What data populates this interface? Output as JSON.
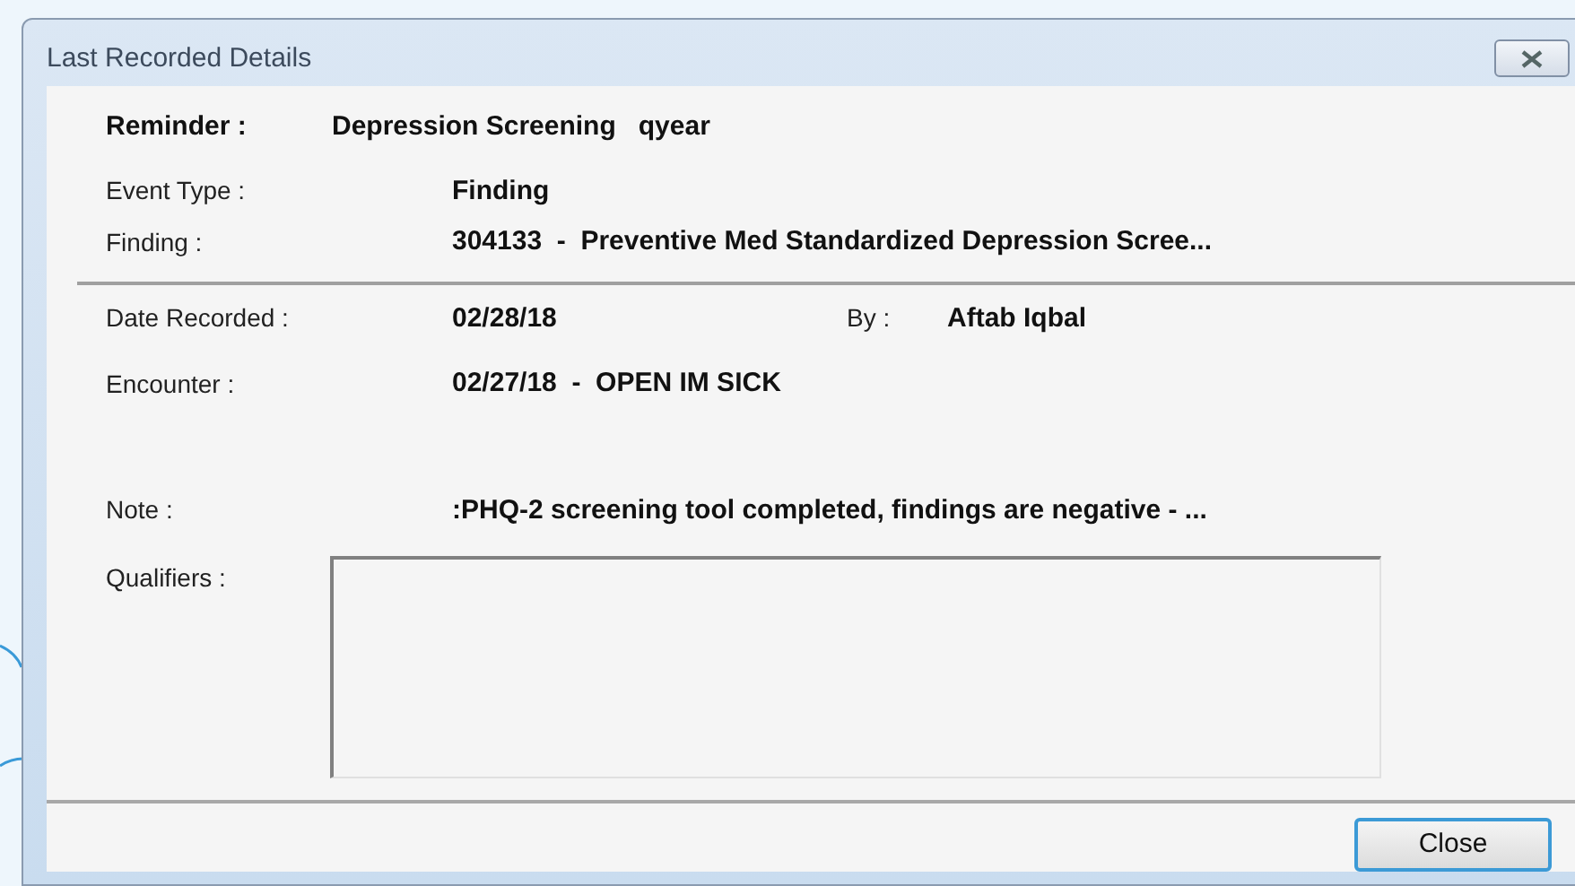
{
  "window": {
    "title": "Last Recorded Details"
  },
  "reminder": {
    "label": "Reminder :",
    "value": "Depression Screening   qyear"
  },
  "event_fields": [
    {
      "label": "Event Type :",
      "value": "Finding"
    },
    {
      "label": "Finding :",
      "value": "304133  -  Preventive Med Standardized Depression Scree..."
    }
  ],
  "date_recorded": {
    "label": "Date Recorded :",
    "value": "02/28/18",
    "by_label": "By :",
    "by_value": "Aftab Iqbal"
  },
  "encounter": {
    "label": "Encounter :",
    "value": "02/27/18  -  OPEN IM SICK"
  },
  "note": {
    "label": "Note :",
    "value": ":PHQ-2 screening tool completed, findings are negative - ..."
  },
  "qualifiers": {
    "label": "Qualifiers :"
  },
  "buttons": [
    "Close"
  ]
}
